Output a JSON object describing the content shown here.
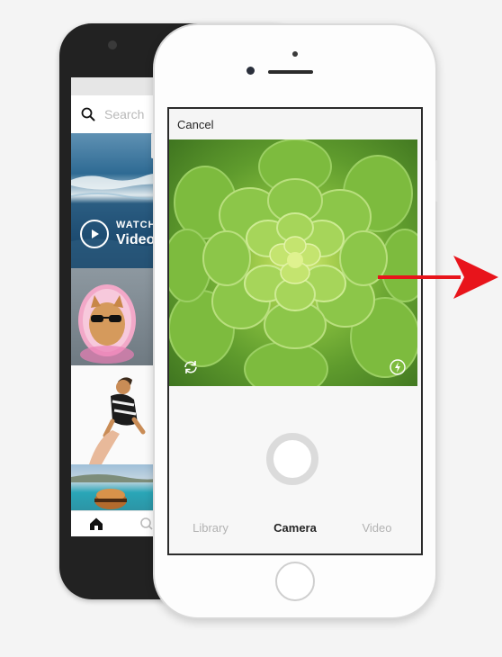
{
  "back_phone": {
    "search_placeholder": "Search",
    "watch_badge": {
      "line1": "WATCH",
      "line2": "Video"
    }
  },
  "front_phone": {
    "cancel_label": "Cancel",
    "modes": {
      "library": "Library",
      "camera": "Camera",
      "video": "Video"
    },
    "selected_mode": "Camera"
  },
  "colors": {
    "arrow": "#e8141b",
    "inactive_tab": "#b2b2b2",
    "active_tab": "#262626",
    "shutter_ring": "#dbdbdb"
  }
}
